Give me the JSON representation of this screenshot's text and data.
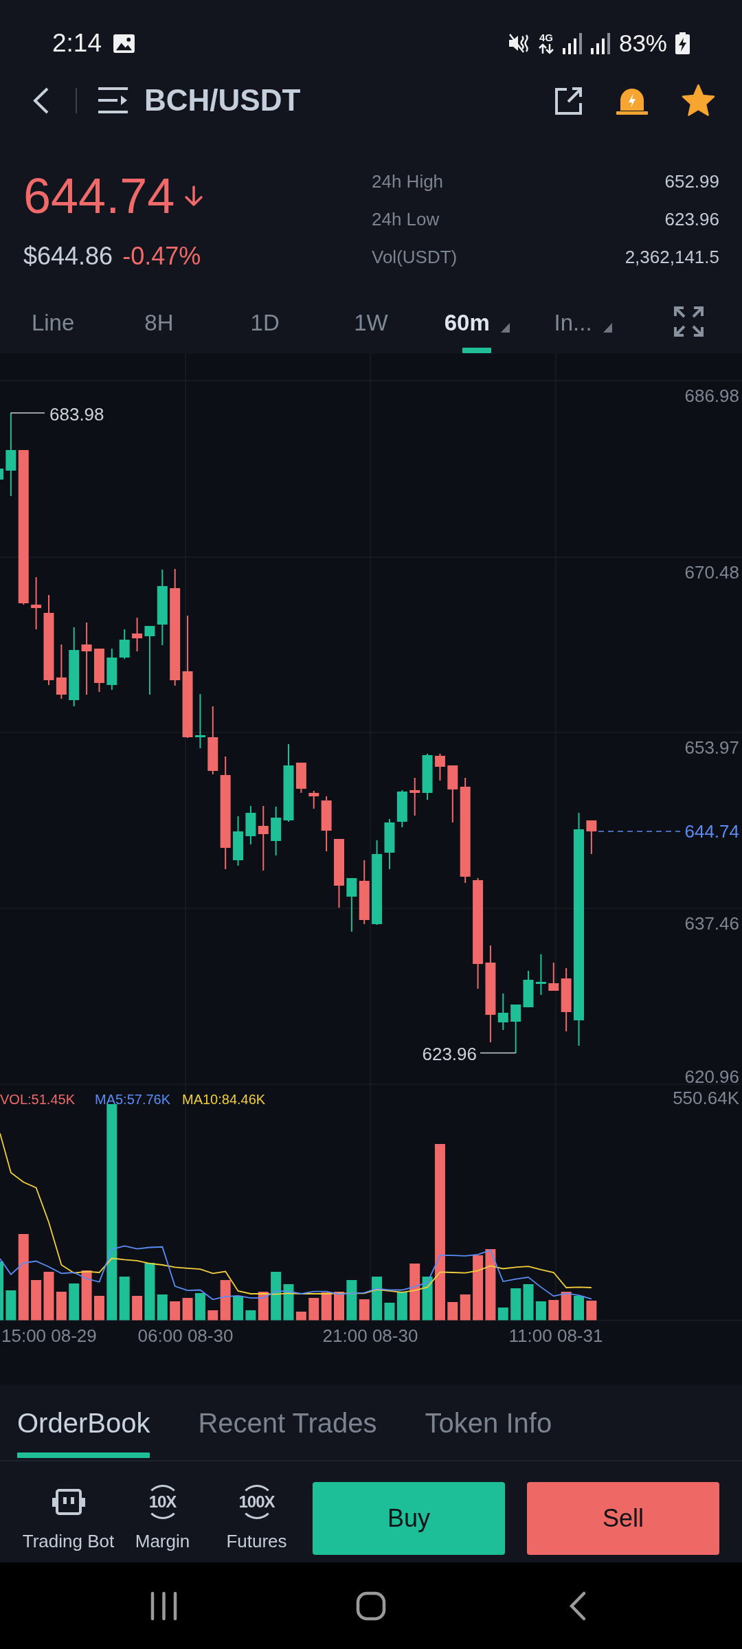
{
  "status_bar": {
    "time": "2:14",
    "network": "4G",
    "battery": "83%"
  },
  "header": {
    "title": "BCH/USDT",
    "favorite": true
  },
  "ticker": {
    "price": "644.74",
    "falling": true,
    "fiat_price": "$644.86",
    "change": "-0.47%",
    "stats": [
      {
        "label": "24h High",
        "value": "652.99"
      },
      {
        "label": "24h Low",
        "value": "623.96"
      },
      {
        "label": "Vol(USDT)",
        "value": "2,362,141.5"
      }
    ]
  },
  "intervals": [
    {
      "label": "Line",
      "selected": false,
      "dropdown": false
    },
    {
      "label": "8H",
      "selected": false,
      "dropdown": false
    },
    {
      "label": "1D",
      "selected": false,
      "dropdown": false
    },
    {
      "label": "1W",
      "selected": false,
      "dropdown": false
    },
    {
      "label": "60m",
      "selected": true,
      "dropdown": true
    },
    {
      "label": "In...",
      "selected": false,
      "dropdown": true
    }
  ],
  "price_chart": {
    "axis_labels": [
      "686.98",
      "670.48",
      "653.97",
      "637.46",
      "620.96"
    ],
    "high_label": "683.98",
    "low_label": "623.96",
    "last_price_label": "644.74"
  },
  "volume_chart": {
    "legend": [
      {
        "text": "VOL:51.45K",
        "color": "#ef6a68"
      },
      {
        "text": "MA5:57.76K",
        "color": "#5b8df6"
      },
      {
        "text": "MA10:84.46K",
        "color": "#f2cf3c"
      }
    ],
    "max_label": "550.64K",
    "time_labels": [
      "15:00 08-29",
      "06:00 08-30",
      "21:00 08-30",
      "11:00 08-31"
    ]
  },
  "bottom_tabs": [
    {
      "label": "OrderBook",
      "selected": true
    },
    {
      "label": "Recent Trades",
      "selected": false
    },
    {
      "label": "Token Info",
      "selected": false
    }
  ],
  "shortcuts": [
    {
      "kind": "bot",
      "label": "Trading Bot"
    },
    {
      "kind": "leverage",
      "badge": "10X",
      "label": "Margin"
    },
    {
      "kind": "leverage",
      "badge": "100X",
      "label": "Futures"
    }
  ],
  "actions": [
    {
      "kind": "buy",
      "label": "Buy"
    },
    {
      "kind": "sell",
      "label": "Sell"
    }
  ]
}
